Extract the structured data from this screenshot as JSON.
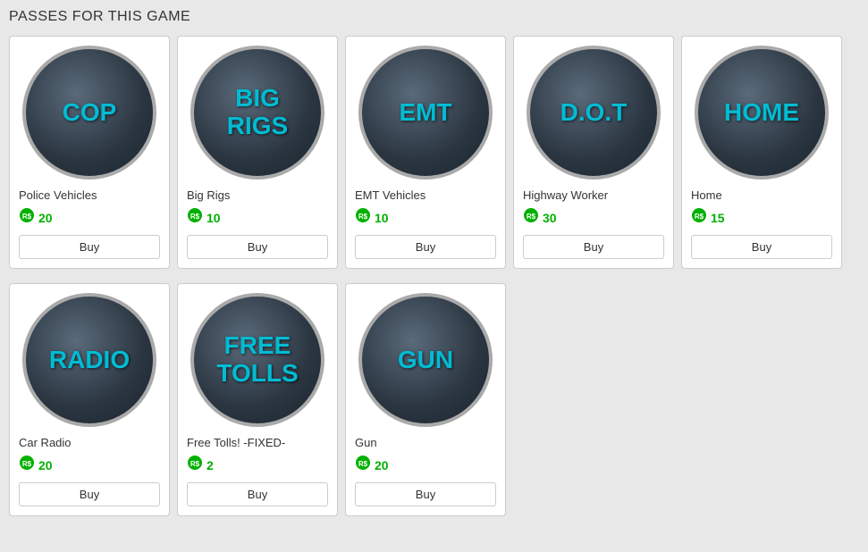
{
  "title": "PASSES FOR THIS GAME",
  "passes": [
    {
      "id": "cop",
      "icon_text": "COP",
      "name": "Police Vehicles",
      "price": 20,
      "row": 0
    },
    {
      "id": "big-rigs",
      "icon_text": "BIG\nRIGS",
      "name": "Big Rigs",
      "price": 10,
      "row": 0
    },
    {
      "id": "emt",
      "icon_text": "EMT",
      "name": "EMT Vehicles",
      "price": 10,
      "row": 0
    },
    {
      "id": "dot",
      "icon_text": "D.O.T",
      "name": "Highway Worker",
      "price": 30,
      "row": 0
    },
    {
      "id": "home",
      "icon_text": "HOME",
      "name": "Home",
      "price": 15,
      "row": 0
    },
    {
      "id": "radio",
      "icon_text": "RADIO",
      "name": "Car Radio",
      "price": 20,
      "row": 1
    },
    {
      "id": "free-tolls",
      "icon_text": "FREE\nTOLLS",
      "name": "Free Tolls! -FIXED-",
      "price": 2,
      "row": 1
    },
    {
      "id": "gun",
      "icon_text": "GUN",
      "name": "Gun",
      "price": 20,
      "row": 1
    }
  ],
  "buy_label": "Buy",
  "currency_symbol": "R$"
}
